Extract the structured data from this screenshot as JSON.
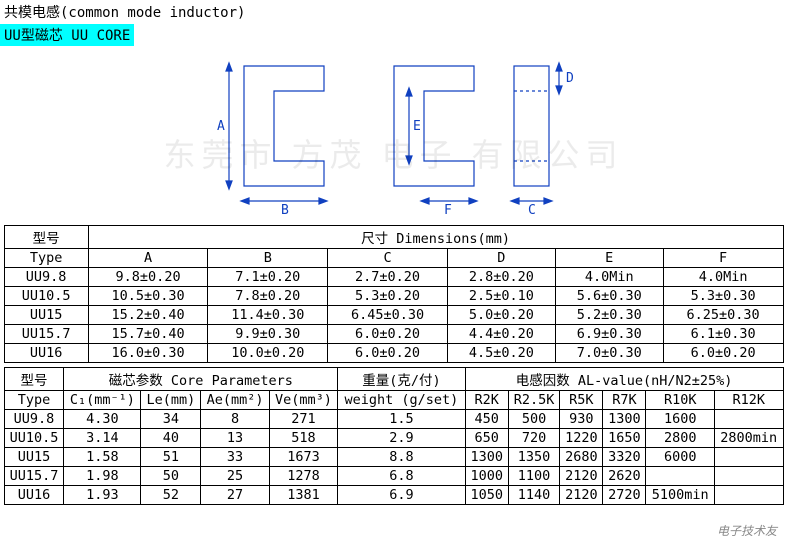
{
  "title": "共模电感(common mode inductor)",
  "subtitle": "UU型磁芯   UU CORE",
  "watermark": "东莞市 方茂 电子 有限公司",
  "footer_mark": "电子技术友",
  "dim_letters": {
    "A": "A",
    "B": "B",
    "E": "E",
    "F": "F",
    "C": "C",
    "D": "D"
  },
  "table1": {
    "h_type_cn": "型号",
    "h_type_en": "Type",
    "h_dim": "尺寸 Dimensions(mm)",
    "cols": [
      "A",
      "B",
      "C",
      "D",
      "E",
      "F"
    ],
    "rows": [
      {
        "type": "UU9.8",
        "A": "9.8±0.20",
        "B": "7.1±0.20",
        "C": "2.7±0.20",
        "D": "2.8±0.20",
        "E": "4.0Min",
        "F": "4.0Min"
      },
      {
        "type": "UU10.5",
        "A": "10.5±0.30",
        "B": "7.8±0.20",
        "C": "5.3±0.20",
        "D": "2.5±0.10",
        "E": "5.6±0.30",
        "F": "5.3±0.30"
      },
      {
        "type": "UU15",
        "A": "15.2±0.40",
        "B": "11.4±0.30",
        "C": "6.45±0.30",
        "D": "5.0±0.20",
        "E": "5.2±0.30",
        "F": "6.25±0.30"
      },
      {
        "type": "UU15.7",
        "A": "15.7±0.40",
        "B": "9.9±0.30",
        "C": "6.0±0.20",
        "D": "4.4±0.20",
        "E": "6.9±0.30",
        "F": "6.1±0.30"
      },
      {
        "type": "UU16",
        "A": "16.0±0.30",
        "B": "10.0±0.20",
        "C": "6.0±0.20",
        "D": "4.5±0.20",
        "E": "7.0±0.30",
        "F": "6.0±0.20"
      }
    ]
  },
  "table2": {
    "h_type_cn": "型号",
    "h_type_en": "Type",
    "h_core": "磁芯参数 Core Parameters",
    "h_weight_cn": "重量(克/付)",
    "h_weight_en": "weight (g/set)",
    "h_al": "电感因数 AL-value(nH/N2±25%)",
    "core_cols": [
      "C₁(mm⁻¹)",
      "Le(mm)",
      "Ae(mm²)",
      "Ve(mm³)"
    ],
    "al_cols": [
      "R2K",
      "R2.5K",
      "R5K",
      "R7K",
      "R10K",
      "R12K"
    ],
    "rows": [
      {
        "type": "UU9.8",
        "C1": "4.30",
        "Le": "34",
        "Ae": "8",
        "Ve": "271",
        "w": "1.5",
        "al": [
          "450",
          "500",
          "930",
          "1300",
          "1600",
          ""
        ]
      },
      {
        "type": "UU10.5",
        "C1": "3.14",
        "Le": "40",
        "Ae": "13",
        "Ve": "518",
        "w": "2.9",
        "al": [
          "650",
          "720",
          "1220",
          "1650",
          "2800",
          "2800min"
        ]
      },
      {
        "type": "UU15",
        "C1": "1.58",
        "Le": "51",
        "Ae": "33",
        "Ve": "1673",
        "w": "8.8",
        "al": [
          "1300",
          "1350",
          "2680",
          "3320",
          "6000",
          ""
        ]
      },
      {
        "type": "UU15.7",
        "C1": "1.98",
        "Le": "50",
        "Ae": "25",
        "Ve": "1278",
        "w": "6.8",
        "al": [
          "1000",
          "1100",
          "2120",
          "2620",
          "",
          ""
        ]
      },
      {
        "type": "UU16",
        "C1": "1.93",
        "Le": "52",
        "Ae": "27",
        "Ve": "1381",
        "w": "6.9",
        "al": [
          "1050",
          "1140",
          "2120",
          "2720",
          "5100min",
          ""
        ]
      }
    ]
  }
}
